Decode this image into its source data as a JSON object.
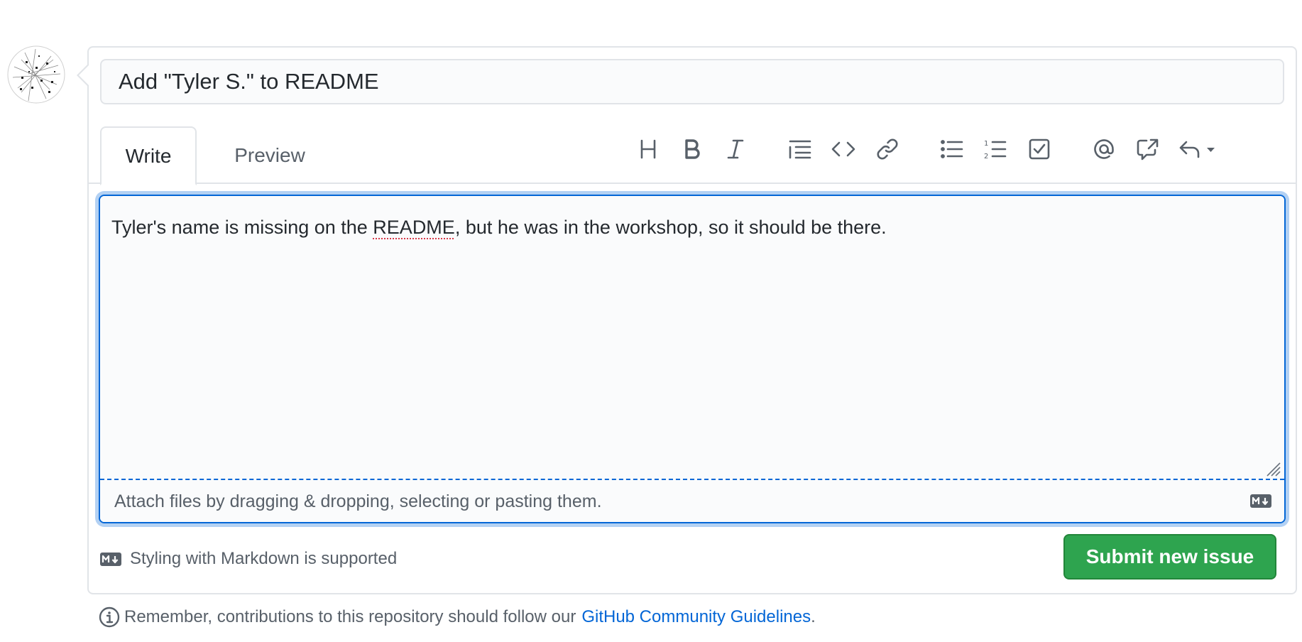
{
  "issue_form": {
    "title_value": "Add \"Tyler S.\" to README",
    "tabs": [
      {
        "label": "Write",
        "active": true
      },
      {
        "label": "Preview",
        "active": false
      }
    ],
    "toolbar": [
      {
        "name": "heading-icon"
      },
      {
        "name": "bold-icon"
      },
      {
        "name": "italic-icon"
      },
      {
        "name": "quote-icon"
      },
      {
        "name": "code-icon"
      },
      {
        "name": "link-icon"
      },
      {
        "name": "unordered-list-icon"
      },
      {
        "name": "ordered-list-icon"
      },
      {
        "name": "task-list-icon"
      },
      {
        "name": "mention-icon"
      },
      {
        "name": "cross-reference-icon"
      },
      {
        "name": "reply-dropdown-icon"
      }
    ],
    "body": {
      "text_before": "Tyler's name is missing on the ",
      "text_flagged": "README",
      "text_after": ", but he was in the workshop, so it should be there."
    },
    "attach_text": "Attach files by dragging & dropping, selecting or pasting them.",
    "markdown_note": "Styling with Markdown is supported",
    "submit_label": "Submit new issue",
    "guidelines": {
      "prefix": "Remember, contributions to this repository should follow our",
      "link_text": "GitHub Community Guidelines",
      "suffix": "."
    }
  },
  "colors": {
    "accent_blue": "#0366d6",
    "submit_green": "#2ea44f",
    "border_gray": "#e1e4e8",
    "muted_text": "#586069"
  }
}
